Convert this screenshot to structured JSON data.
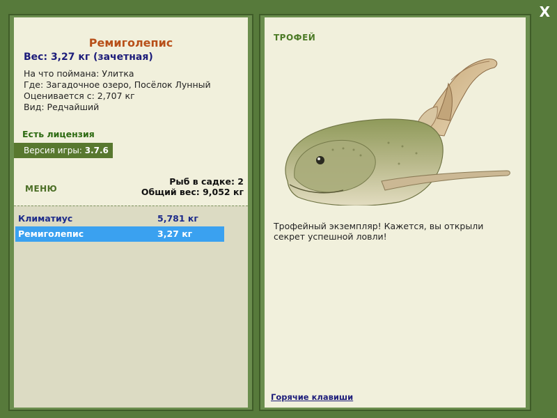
{
  "close_label": "X",
  "catch": {
    "name": "Ремиголепис",
    "weight_line": "Вес: 3,27 кг (зачетная)",
    "details": [
      "На что поймана: Улитка",
      "Где: Загадочное озеро, Посёлок Лунный",
      "Оценивается с: 2,707 кг",
      "Вид: Редчайший"
    ]
  },
  "license": "Есть лицензия",
  "version": {
    "label": "Версия игры: ",
    "value": "3.7.6"
  },
  "menu_label": "МЕНЮ",
  "keep": {
    "count_line": "Рыб в садке: 2",
    "total_line": "Общий вес: 9,052 кг"
  },
  "fish_list": [
    {
      "name": "Климатиус",
      "weight": "5,781 кг",
      "selected": false
    },
    {
      "name": "Ремиголепис",
      "weight": "3,27 кг",
      "selected": true
    }
  ],
  "trophy": {
    "title": "ТРОФЕЙ",
    "message": "Трофейный экземпляр! Кажется, вы открыли секрет успешной ловли!"
  },
  "hotkeys_label": "Горячие клавиши",
  "colors": {
    "background": "#577a3b",
    "panel": "#f1f0dc",
    "name_accent": "#b8501a",
    "selection": "#3aa1f0"
  }
}
